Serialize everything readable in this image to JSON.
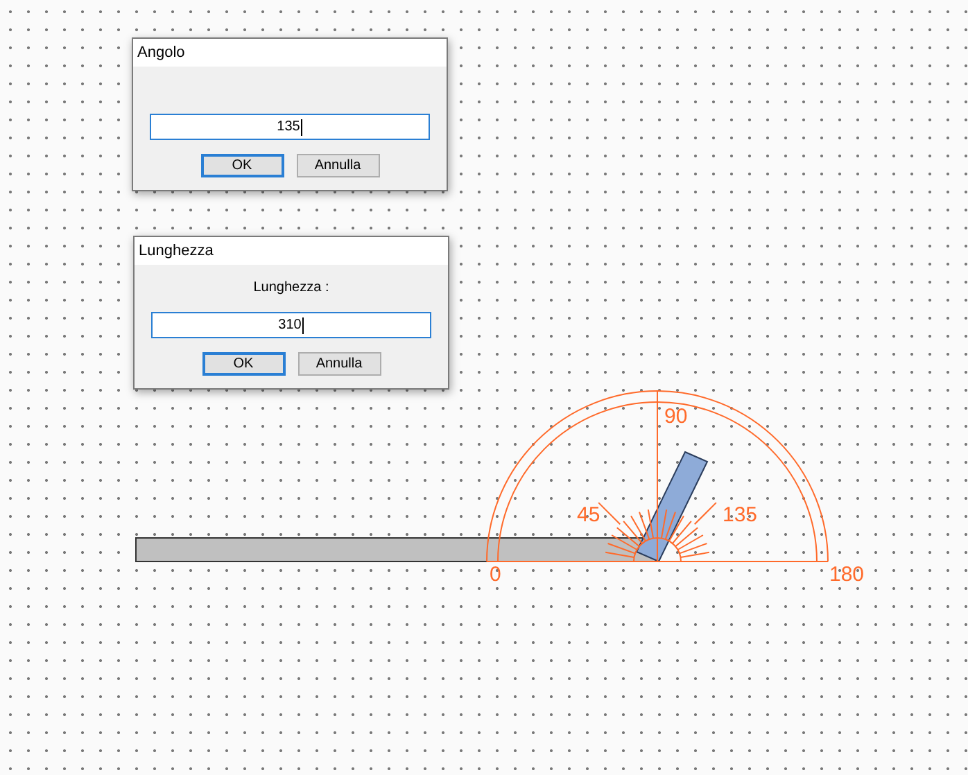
{
  "dialogs": [
    {
      "title": "Angolo",
      "value": "135",
      "field_focused": true,
      "buttons": [
        {
          "label": "OK",
          "focused": true
        },
        {
          "label": "Annulla",
          "focused": false
        }
      ]
    },
    {
      "title": "Lunghezza",
      "prompt": "Lunghezza :",
      "value": "310",
      "field_focused": true,
      "buttons": [
        {
          "label": "OK",
          "focused": true
        },
        {
          "label": "Annulla",
          "focused": false
        }
      ]
    }
  ],
  "protractor": {
    "labels": [
      "0",
      "45",
      "90",
      "135",
      "180"
    ]
  }
}
